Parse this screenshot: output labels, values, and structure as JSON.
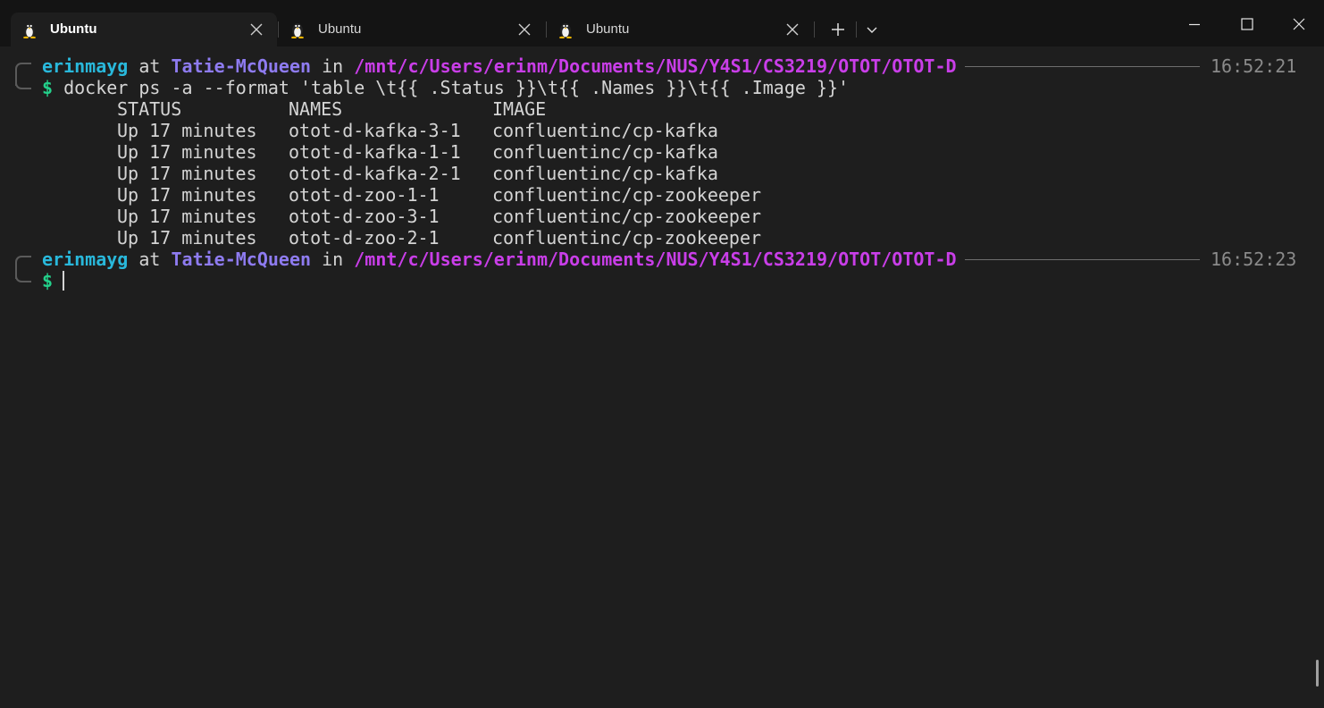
{
  "tabs": [
    {
      "label": "Ubuntu",
      "active": true,
      "icon": "linux-penguin-icon"
    },
    {
      "label": "Ubuntu",
      "active": false,
      "icon": "linux-penguin-icon"
    },
    {
      "label": "Ubuntu",
      "active": false,
      "icon": "linux-penguin-icon"
    }
  ],
  "window_controls": [
    "minimize-icon",
    "maximize-icon",
    "close-icon"
  ],
  "colors": {
    "user": "#29b8db",
    "host": "#8e7bf0",
    "path": "#c93ee8",
    "dollar": "#23d18b",
    "background": "#1e1e1e"
  },
  "prompts": [
    {
      "user": "erinmayg",
      "at": "at",
      "host": "Tatie-McQueen",
      "in": "in",
      "path": "/mnt/c/Users/erinm/Documents/NUS/Y4S1/CS3219/OTOT/OTOT-D",
      "time": "16:52:21",
      "symbol": "$",
      "command": "docker ps -a --format 'table \\t{{ .Status }}\\t{{ .Names }}\\t{{ .Image }}'"
    },
    {
      "user": "erinmayg",
      "at": "at",
      "host": "Tatie-McQueen",
      "in": "in",
      "path": "/mnt/c/Users/erinm/Documents/NUS/Y4S1/CS3219/OTOT/OTOT-D",
      "time": "16:52:23",
      "symbol": "$",
      "command": ""
    }
  ],
  "output": {
    "headers": [
      "STATUS",
      "NAMES",
      "IMAGE"
    ],
    "rows": [
      [
        "Up 17 minutes",
        "otot-d-kafka-3-1",
        "confluentinc/cp-kafka"
      ],
      [
        "Up 17 minutes",
        "otot-d-kafka-1-1",
        "confluentinc/cp-kafka"
      ],
      [
        "Up 17 minutes",
        "otot-d-kafka-2-1",
        "confluentinc/cp-kafka"
      ],
      [
        "Up 17 minutes",
        "otot-d-zoo-1-1",
        "confluentinc/cp-zookeeper"
      ],
      [
        "Up 17 minutes",
        "otot-d-zoo-3-1",
        "confluentinc/cp-zookeeper"
      ],
      [
        "Up 17 minutes",
        "otot-d-zoo-2-1",
        "confluentinc/cp-zookeeper"
      ]
    ]
  }
}
